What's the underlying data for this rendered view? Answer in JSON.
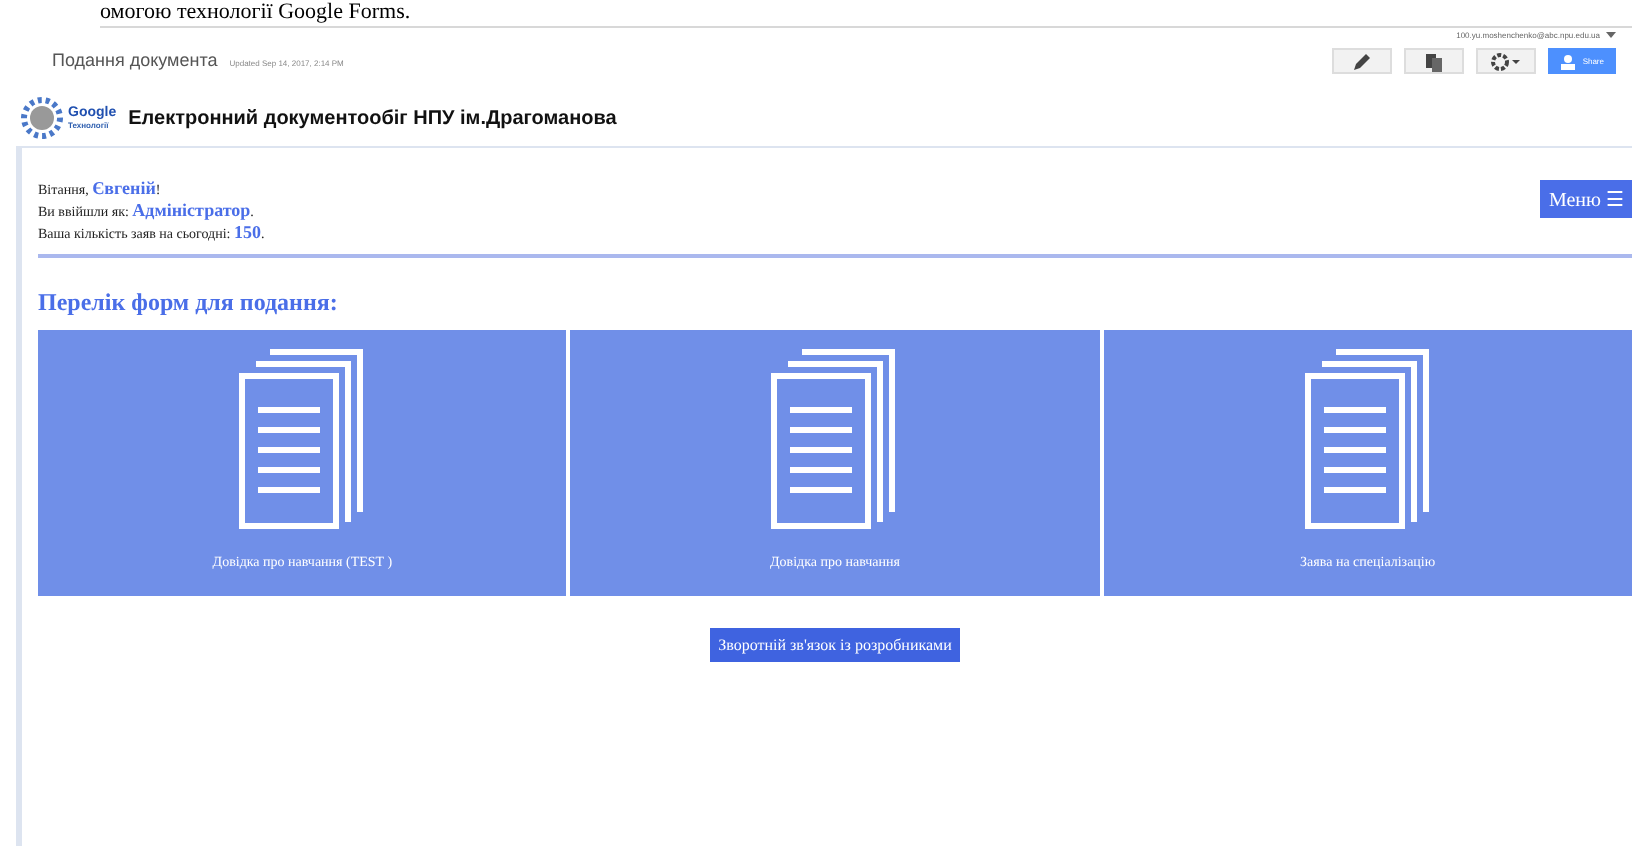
{
  "document_text": "омогою технології Google Forms.",
  "site": {
    "name": "Подання документа",
    "updated": "Updated Sep 14, 2017, 2:14 PM",
    "account": "100.yu.moshenchenko@abc.npu.edu.ua",
    "share_label": "Share"
  },
  "header": {
    "logo_text": "Google",
    "logo_subtext": "Технології",
    "title": "Електронний документообіг НПУ ім.Драгоманова"
  },
  "greeting": [
    {
      "label": "Вітання, ",
      "value": "Євгеній",
      "suffix": "!"
    },
    {
      "label": "Ви ввійшли як: ",
      "value": "Адміністратор",
      "suffix": "."
    },
    {
      "label": "Ваша кількість заяв на сьогодні: ",
      "value": "150",
      "suffix": "."
    }
  ],
  "menu_button": "Меню ☰",
  "forms_heading": "Перелік форм для подання:",
  "forms": [
    {
      "label": "Довідка про навчання (TEST )"
    },
    {
      "label": "Довідка про навчання"
    },
    {
      "label": "Заява на спеціалізацію"
    }
  ],
  "feedback_button": "Зворотній зв'язок із розробниками"
}
